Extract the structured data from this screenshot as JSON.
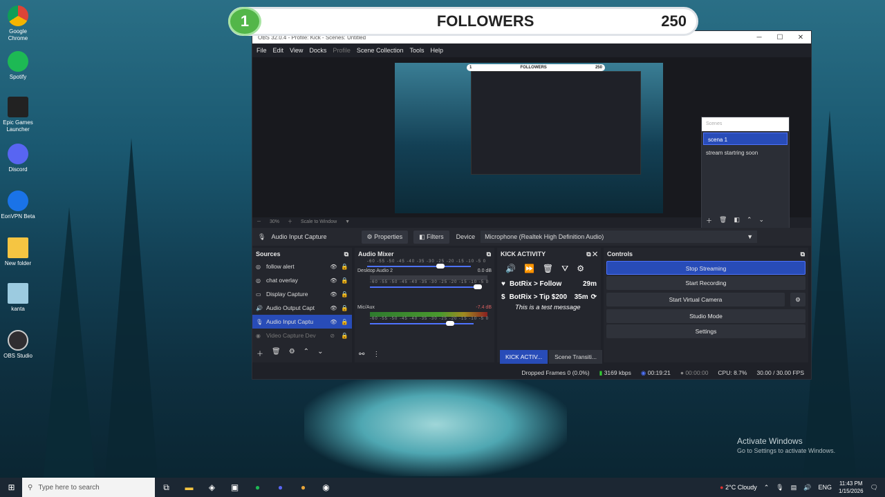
{
  "desktop": {
    "icons": [
      {
        "label": "Google Chrome",
        "color": "#e8a53a"
      },
      {
        "label": "Spotify",
        "color": "#1db954"
      },
      {
        "label": "Epic Games Launcher",
        "color": "#222"
      },
      {
        "label": "Discord",
        "color": "#5865f2"
      },
      {
        "label": "EonVPN Beta",
        "color": "#1a73e8"
      },
      {
        "label": "New folder",
        "color": "#f5c542"
      },
      {
        "label": "kanta",
        "color": "#9ccbe0"
      },
      {
        "label": "OBS Studio",
        "color": "#302e31"
      }
    ]
  },
  "overlay": {
    "rank": "1",
    "title": "FOLLOWERS",
    "count": "250"
  },
  "obs": {
    "window_title": "OBS 32.0.4 - Profile: Kick - Scenes: Untitled",
    "menu": [
      "File",
      "Edit",
      "View",
      "Docks",
      "Profile",
      "Scene Collection",
      "Tools",
      "Help"
    ],
    "scenes": {
      "header": "Scenes",
      "items": [
        "scena 1",
        "stream  startring soon"
      ]
    },
    "zoom": {
      "level": "30%",
      "scale_label": "Scale to Window"
    },
    "source_bar": {
      "source_name": "Audio Input Capture",
      "properties": "Properties",
      "filters": "Filters",
      "device_label": "Device",
      "device_value": "Microphone (Realtek High Definition Audio)"
    },
    "sources": {
      "title": "Sources",
      "items": [
        {
          "label": "follow alert"
        },
        {
          "label": "chat overlay"
        },
        {
          "label": "Display Capture"
        },
        {
          "label": "Audio Output Capt"
        },
        {
          "label": "Audio Input Captu"
        },
        {
          "label": "Video Capture Dev"
        }
      ]
    },
    "mixer": {
      "title": "Audio Mixer",
      "ticks": "-60 -55 -50 -45 -40 -35 -30 -25 -20 -15 -10 -5 0",
      "channels": [
        {
          "name": "Desktop Audio 2",
          "level": "0.0 dB"
        },
        {
          "name": "Mic/Aux",
          "level": "-7.4 dB"
        }
      ]
    },
    "kick": {
      "title": "KICK ACTIVITY",
      "events": [
        {
          "text": "BotRix > Follow",
          "time": "29m"
        },
        {
          "text": "BotRix > Tip $200",
          "time": "35m",
          "message": "This is a test message"
        }
      ]
    },
    "controls": {
      "title": "Controls",
      "buttons": [
        "Stop Streaming",
        "Start Recording",
        "Start Virtual Camera",
        "Studio Mode",
        "Settings"
      ]
    },
    "tabs": [
      "KICK ACTIV...",
      "Scene Transiti..."
    ],
    "status": {
      "dropped": "Dropped Frames 0 (0.0%)",
      "bitrate": "3169 kbps",
      "stream_time": "00:19:21",
      "rec_time": "00:00:00",
      "cpu": "CPU: 8.7%",
      "fps": "30.00 / 30.00 FPS"
    }
  },
  "watermark": {
    "title": "Activate Windows",
    "subtitle": "Go to Settings to activate Windows."
  },
  "taskbar": {
    "search_placeholder": "Type here to search",
    "weather": "2°C  Cloudy",
    "lang": "ENG",
    "time": "11:43 PM",
    "date": "1/15/2026"
  }
}
